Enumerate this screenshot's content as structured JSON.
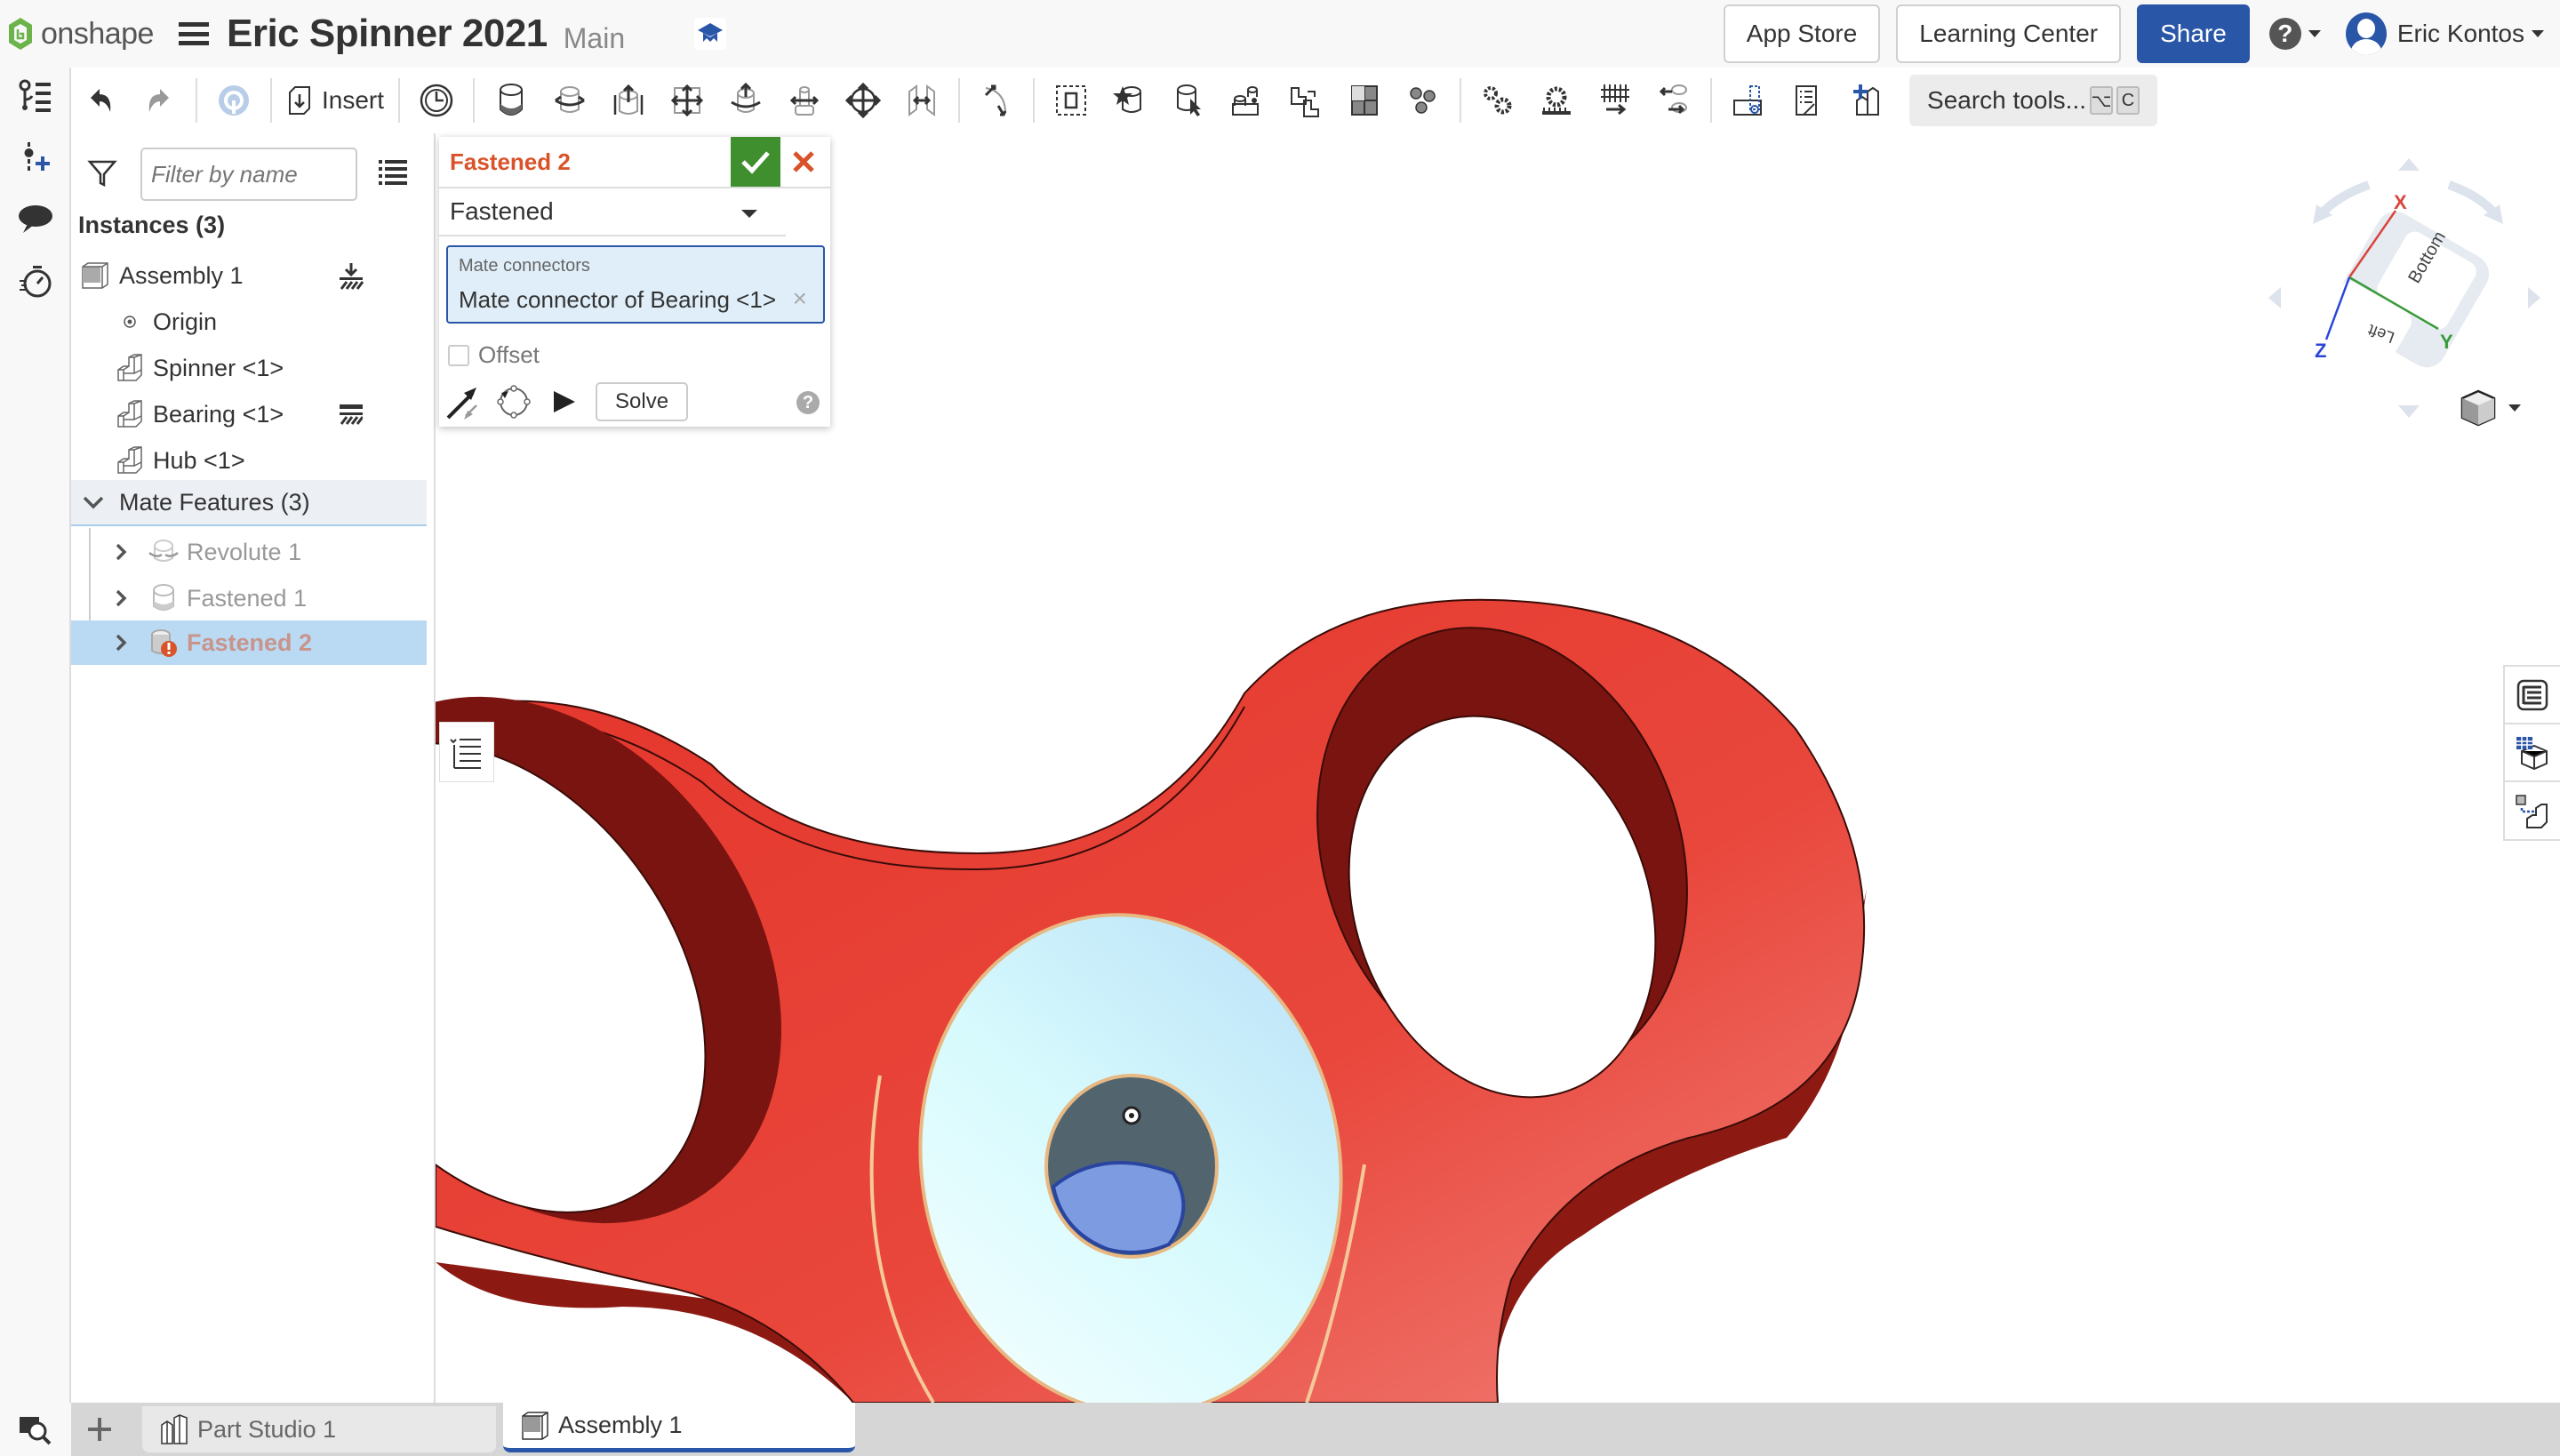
{
  "header": {
    "app_name": "onshape",
    "document_title": "Eric Spinner 2021",
    "branch": "Main",
    "buttons": {
      "app_store": "App Store",
      "learning_center": "Learning Center",
      "share": "Share"
    },
    "help_glyph": "?",
    "user_name": "Eric Kontos"
  },
  "colors": {
    "accent_blue": "#2a56a8",
    "logo_green": "#6bb34a",
    "confirm_green": "#3f8f2e",
    "error_orange": "#d9532a",
    "part_red": "#e8392d",
    "selection_blue": "#b9daf2",
    "connector_face": "#dff6fb"
  },
  "left_rail": {
    "icons": [
      "feature-list-icon",
      "insert-mate-connector-icon",
      "comments-icon",
      "performance-icon"
    ]
  },
  "toolbar": {
    "insert_label": "Insert",
    "search_placeholder": "Search tools...",
    "search_shortcut": [
      "⌥",
      "C"
    ],
    "tools": [
      "undo-icon",
      "redo-icon",
      "onshape-render-icon",
      "insert-icon",
      "named-positions-icon",
      "fastened-mate-icon",
      "revolute-mate-icon",
      "slider-mate-icon",
      "planar-mate-icon",
      "cylindrical-mate-icon",
      "pin-slot-mate-icon",
      "ball-mate-icon",
      "parallel-mate-icon",
      "tangent-mate-icon",
      "group-icon",
      "mate-connector-icon",
      "replicate-icon",
      "pattern-icon",
      "explode-icon",
      "gear-relation-icon",
      "rack-pinion-icon",
      "screw-relation-icon",
      "linear-relation-icon",
      "mate-connector-axis-icon",
      "bom-icon",
      "insert-part-icon"
    ]
  },
  "feature_panel": {
    "filter_placeholder": "Filter by name",
    "instances_title": "Instances (3)",
    "instances": [
      {
        "label": "Assembly 1",
        "icon": "assembly-icon",
        "badge": "fixed-icon"
      },
      {
        "label": "Origin",
        "icon": "origin-icon"
      },
      {
        "label": "Spinner <1>",
        "icon": "part-icon"
      },
      {
        "label": "Bearing <1>",
        "icon": "part-icon",
        "badge": "grounded-icon"
      },
      {
        "label": "Hub <1>",
        "icon": "part-icon"
      }
    ],
    "mate_features_title": "Mate Features (3)",
    "mate_features": [
      {
        "label": "Revolute 1",
        "icon": "revolute-mate-icon",
        "selected": false,
        "error": false
      },
      {
        "label": "Fastened 1",
        "icon": "fastened-mate-icon",
        "selected": false,
        "error": false
      },
      {
        "label": "Fastened 2",
        "icon": "fastened-mate-icon",
        "selected": true,
        "error": true
      }
    ]
  },
  "mate_dialog": {
    "title": "Fastened 2",
    "mate_type": "Fastened",
    "mate_connectors_label": "Mate connectors",
    "mate_connector_value": "Mate connector of Bearing <1>",
    "remove_glyph": "×",
    "offset_label": "Offset",
    "offset_checked": false,
    "solve_label": "Solve",
    "help_glyph": "?"
  },
  "view_cube": {
    "faces": [
      "Bottom",
      "Left"
    ],
    "axes": [
      "X",
      "Y",
      "Z"
    ],
    "axis_colors": {
      "X": "#d9453a",
      "Y": "#3a9a3a",
      "Z": "#2a45d8"
    }
  },
  "right_dock": {
    "icons": [
      "appearance-panel-icon",
      "bom-table-icon",
      "mate-connector-list-icon"
    ]
  },
  "bottom_tabs": {
    "tabs": [
      {
        "label": "Part Studio 1",
        "icon": "part-studio-icon",
        "active": false
      },
      {
        "label": "Assembly 1",
        "icon": "assembly-icon",
        "active": true
      }
    ]
  }
}
